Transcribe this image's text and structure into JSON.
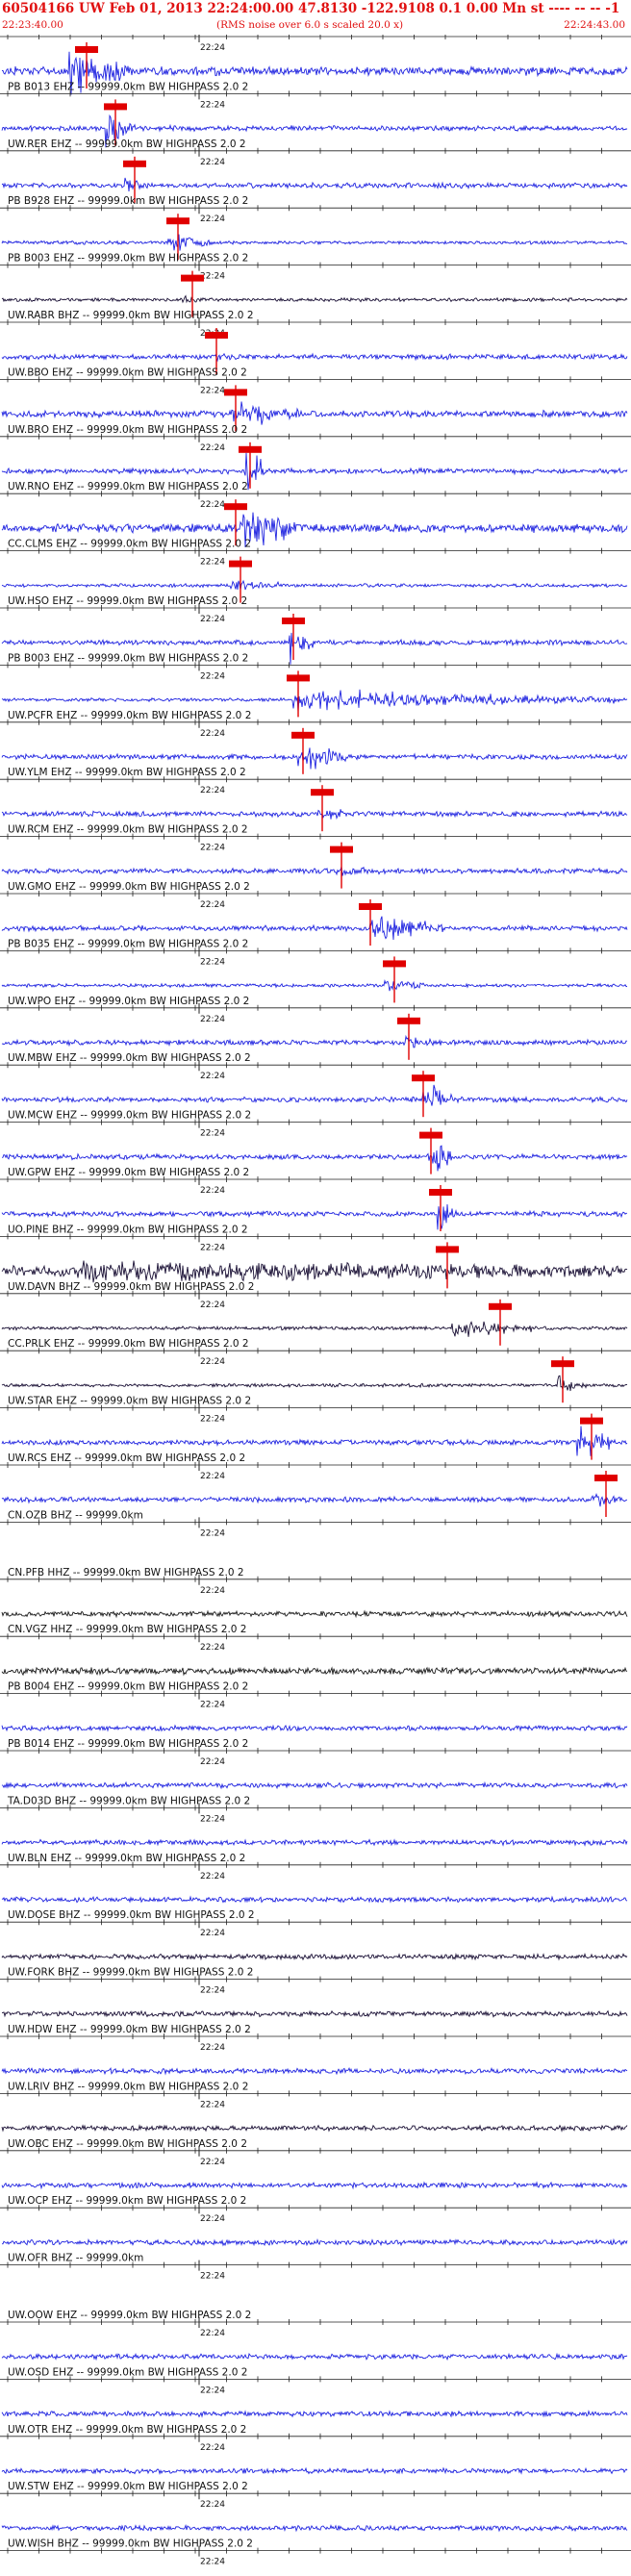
{
  "header": {
    "title": "60504166 UW Feb 01, 2013 22:24:00.00   47.8130 -122.9108  0.1 0.00 Mn st ---- -- -- -1",
    "start_time": "22:23:40.00",
    "noise_note": "(RMS noise over 6.0 s scaled 20.0 x)",
    "end_time": "22:24:43.00"
  },
  "tick_time_label": "22:24",
  "colors": {
    "trace_blue": "#1f23e0",
    "trace_dark": "#1a1035",
    "trace_black": "#1c1c1c",
    "pick_marker": "#e00000",
    "header_text": "#e01010"
  },
  "traces": [
    {
      "label": "",
      "color": "blue",
      "amp": 5,
      "burst": [
        70,
        140,
        26
      ],
      "pick": 90
    },
    {
      "label": "PB B013 EHZ -- 99999.0km BW  HIGHPASS  2.0  2",
      "color": "blue",
      "amp": 3,
      "burst": [
        110,
        140,
        20
      ],
      "pick": 120
    },
    {
      "label": "UW.RER EHZ -- 99999.0km BW  HIGHPASS  2.0  2",
      "color": "blue",
      "amp": 3,
      "burst": [
        130,
        150,
        10
      ],
      "pick": 140
    },
    {
      "label": "PB B928 EHZ -- 99999.0km BW  HIGHPASS  2.0  2",
      "color": "blue",
      "amp": 2,
      "burst": [
        175,
        220,
        12
      ],
      "pick": 185
    },
    {
      "label": "PB B003 EHZ -- 99999.0km BW  HIGHPASS  2.0  2",
      "color": "dark",
      "amp": 2,
      "burst": [
        190,
        220,
        6
      ],
      "pick": 200
    },
    {
      "label": "UW.RABR BHZ -- 99999.0km BW  HIGHPASS  2.0  2",
      "color": "blue",
      "amp": 3,
      "burst": [
        220,
        250,
        4
      ],
      "pick": 225
    },
    {
      "label": "UW.BBO EHZ -- 99999.0km BW  HIGHPASS  2.0  2",
      "color": "blue",
      "amp": 4,
      "burst": [
        240,
        310,
        16
      ],
      "pick": 245
    },
    {
      "label": "UW.BRO EHZ -- 99999.0km BW  HIGHPASS  2.0  2",
      "color": "blue",
      "amp": 3,
      "burst": [
        255,
        280,
        26
      ],
      "pick": 260
    },
    {
      "label": "UW.RNO EHZ -- 99999.0km BW  HIGHPASS  2.0  2",
      "color": "blue",
      "amp": 5,
      "burst": [
        250,
        310,
        30
      ],
      "pick": 245
    },
    {
      "label": "CC.CLMS EHZ -- 99999.0km BW  HIGHPASS  2.0  2",
      "color": "blue",
      "amp": 2,
      "burst": [
        240,
        290,
        8
      ],
      "pick": 250
    },
    {
      "label": "UW.HSO EHZ -- 99999.0km BW  HIGHPASS  2.0  2",
      "color": "blue",
      "amp": 3,
      "burst": [
        300,
        325,
        26
      ],
      "pick": 305
    },
    {
      "label": "PB B003 EHZ -- 99999.0km BW  HIGHPASS  2.0  2",
      "color": "blue",
      "amp": 2,
      "burst": [
        305,
        640,
        12
      ],
      "pick": 310
    },
    {
      "label": "UW.PCFR EHZ -- 99999.0km BW  HIGHPASS  2.0  2",
      "color": "blue",
      "amp": 3,
      "burst": [
        310,
        360,
        20
      ],
      "pick": 315
    },
    {
      "label": "UW.YLM EHZ -- 99999.0km BW  HIGHPASS  2.0  2",
      "color": "blue",
      "amp": 3,
      "burst": [
        330,
        360,
        8
      ],
      "pick": 335
    },
    {
      "label": "UW.RCM EHZ -- 99999.0km BW  HIGHPASS  2.0  2",
      "color": "blue",
      "amp": 3,
      "burst": [
        350,
        380,
        8
      ],
      "pick": 355
    },
    {
      "label": "UW.GMO EHZ -- 99999.0km BW  HIGHPASS  2.0  2",
      "color": "blue",
      "amp": 3,
      "burst": [
        385,
        460,
        18
      ],
      "pick": 385
    },
    {
      "label": "PB B035 EHZ -- 99999.0km BW  HIGHPASS  2.0  2",
      "color": "blue",
      "amp": 2,
      "burst": [
        400,
        440,
        6
      ],
      "pick": 410
    },
    {
      "label": "UW.WPO EHZ -- 99999.0km BW  HIGHPASS  2.0  2",
      "color": "blue",
      "amp": 3,
      "burst": [
        420,
        460,
        8
      ],
      "pick": 425
    },
    {
      "label": "UW.MBW EHZ -- 99999.0km BW  HIGHPASS  2.0  2",
      "color": "blue",
      "amp": 3,
      "burst": [
        440,
        470,
        26
      ],
      "pick": 440
    },
    {
      "label": "UW.MCW EHZ -- 99999.0km BW  HIGHPASS  2.0  2",
      "color": "blue",
      "amp": 3,
      "burst": [
        445,
        470,
        28
      ],
      "pick": 448
    },
    {
      "label": "UW.GPW EHZ -- 99999.0km BW  HIGHPASS  2.0  2",
      "color": "blue",
      "amp": 3,
      "burst": [
        455,
        475,
        26
      ],
      "pick": 458
    },
    {
      "label": "UO.PINE BHZ -- 99999.0km BW  HIGHPASS  2.0  2",
      "color": "dark",
      "amp": 6,
      "burst": [
        80,
        640,
        10
      ],
      "pick": 465
    },
    {
      "label": "UW.DAVN BHZ -- 99999.0km BW  HIGHPASS  2.0  2",
      "color": "dark",
      "amp": 2,
      "burst": [
        470,
        560,
        12
      ],
      "pick": 520
    },
    {
      "label": "CC.PRLK EHZ -- 99999.0km BW  HIGHPASS  2.0  2",
      "color": "dark",
      "amp": 2,
      "burst": [
        580,
        610,
        14
      ],
      "pick": 585
    },
    {
      "label": "UW.STAR EHZ -- 99999.0km BW  HIGHPASS  2.0  2",
      "color": "blue",
      "amp": 3,
      "burst": [
        600,
        640,
        18
      ],
      "pick": 615
    },
    {
      "label": "UW.RCS EHZ -- 99999.0km BW  HIGHPASS  2.0  2",
      "color": "blue",
      "amp": 3,
      "burst": [
        615,
        640,
        8
      ],
      "pick": 630
    },
    {
      "label": "CN.OZB BHZ -- 99999.0km",
      "color": "blue",
      "amp": 0,
      "burst": null,
      "pick": null
    },
    {
      "label": "CN.PFB HHZ -- 99999.0km BW  HIGHPASS  2.0  2",
      "color": "black",
      "amp": 3,
      "burst": null,
      "pick": null
    },
    {
      "label": "CN.VGZ HHZ -- 99999.0km BW  HIGHPASS  2.0  2",
      "color": "black",
      "amp": 4,
      "burst": null,
      "pick": null
    },
    {
      "label": "PB B004 EHZ -- 99999.0km BW  HIGHPASS  2.0  2",
      "color": "blue",
      "amp": 3,
      "burst": null,
      "pick": null
    },
    {
      "label": "PB B014 EHZ -- 99999.0km BW  HIGHPASS  2.0  2",
      "color": "blue",
      "amp": 3,
      "burst": null,
      "pick": null
    },
    {
      "label": "TA.D03D BHZ -- 99999.0km BW  HIGHPASS  2.0  2",
      "color": "blue",
      "amp": 3,
      "burst": null,
      "pick": null
    },
    {
      "label": "UW.BLN EHZ -- 99999.0km BW  HIGHPASS  2.0  2",
      "color": "blue",
      "amp": 3,
      "burst": null,
      "pick": null
    },
    {
      "label": "UW.DOSE BHZ -- 99999.0km BW  HIGHPASS  2.0  2",
      "color": "dark",
      "amp": 3,
      "burst": null,
      "pick": null
    },
    {
      "label": "UW.FORK BHZ -- 99999.0km BW  HIGHPASS  2.0  2",
      "color": "dark",
      "amp": 3,
      "burst": null,
      "pick": null
    },
    {
      "label": "UW.HDW EHZ -- 99999.0km BW  HIGHPASS  2.0  2",
      "color": "blue",
      "amp": 3,
      "burst": null,
      "pick": null
    },
    {
      "label": "UW.LRIV BHZ -- 99999.0km BW  HIGHPASS  2.0  2",
      "color": "dark",
      "amp": 3,
      "burst": null,
      "pick": null
    },
    {
      "label": "UW.OBC EHZ -- 99999.0km BW  HIGHPASS  2.0  2",
      "color": "blue",
      "amp": 3,
      "burst": null,
      "pick": null
    },
    {
      "label": "UW.OCP EHZ -- 99999.0km BW  HIGHPASS  2.0  2",
      "color": "blue",
      "amp": 3,
      "burst": null,
      "pick": null
    },
    {
      "label": "UW.OFR BHZ -- 99999.0km",
      "color": "blue",
      "amp": 0,
      "burst": null,
      "pick": null
    },
    {
      "label": "UW.OOW EHZ -- 99999.0km BW  HIGHPASS  2.0  2",
      "color": "blue",
      "amp": 3,
      "burst": null,
      "pick": null
    },
    {
      "label": "UW.OSD EHZ -- 99999.0km BW  HIGHPASS  2.0  2",
      "color": "blue",
      "amp": 3,
      "burst": null,
      "pick": null
    },
    {
      "label": "UW.OTR EHZ -- 99999.0km BW  HIGHPASS  2.0  2",
      "color": "blue",
      "amp": 3,
      "burst": null,
      "pick": null
    },
    {
      "label": "UW.STW EHZ -- 99999.0km BW  HIGHPASS  2.0  2",
      "color": "blue",
      "amp": 3,
      "burst": null,
      "pick": null
    },
    {
      "label": "UW.WISH BHZ -- 99999.0km BW  HIGHPASS  2.0  2",
      "color": "blue",
      "amp": 3,
      "burst": null,
      "pick": null
    }
  ]
}
